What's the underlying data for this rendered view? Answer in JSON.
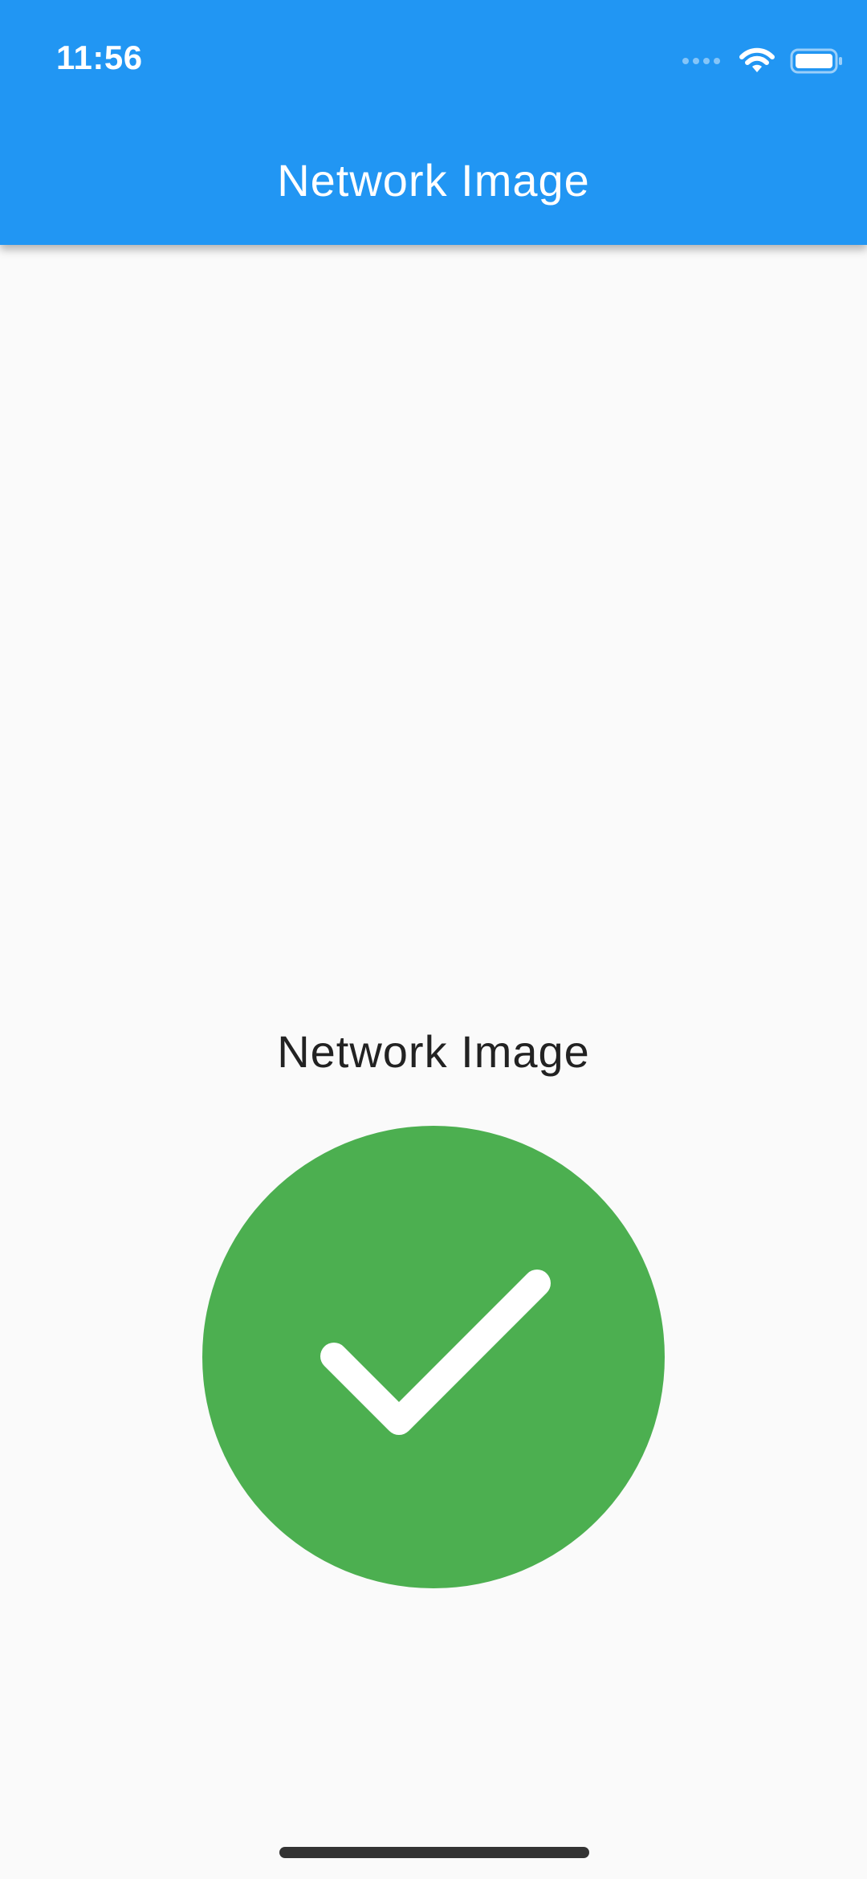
{
  "status_bar": {
    "time": "11:56"
  },
  "app_bar": {
    "title": "Network Image",
    "color": "#2196f3"
  },
  "content": {
    "label": "Network Image",
    "image": {
      "icon": "check-circle-icon",
      "color": "#4caf50"
    }
  },
  "colors": {
    "background": "#fafafa",
    "text": "#222222"
  }
}
